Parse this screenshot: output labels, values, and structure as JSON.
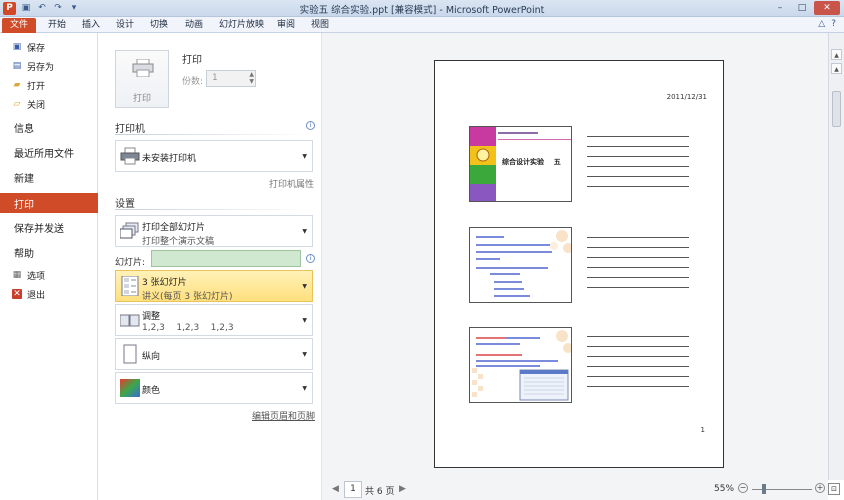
{
  "window": {
    "title": "实验五 综合实验.ppt [兼容模式] - Microsoft PowerPoint",
    "app_icon_letter": "P"
  },
  "ribbon": {
    "tabs": [
      "文件",
      "开始",
      "插入",
      "设计",
      "切换",
      "动画",
      "幻灯片放映",
      "审阅",
      "视图"
    ]
  },
  "nav": {
    "save": "保存",
    "save_as": "另存为",
    "open": "打开",
    "close": "关闭",
    "info": "信息",
    "recent": "最近所用文件",
    "new": "新建",
    "print": "打印",
    "save_send": "保存并发送",
    "help": "帮助",
    "options": "选项",
    "exit": "退出"
  },
  "print": {
    "button_label": "打印",
    "title": "打印",
    "copies_label": "份数:",
    "copies_value": "1"
  },
  "printer": {
    "heading": "打印机",
    "name": "未安装打印机",
    "properties_link": "打印机属性"
  },
  "settings": {
    "heading": "设置",
    "range_title": "打印全部幻灯片",
    "range_sub": "打印整个演示文稿",
    "slides_label": "幻灯片:",
    "slides_value": "",
    "layout_title": "3 张幻灯片",
    "layout_sub": "讲义(每页 3 张幻灯片)",
    "collate_title": "调整",
    "collate_sub": "1,2,3    1,2,3    1,2,3",
    "orientation": "纵向",
    "color": "颜色",
    "header_footer_link": "编辑页眉和页脚"
  },
  "preview": {
    "date": "2011/12/31",
    "page_number": "1",
    "slide1_title": "综合设计实验    五"
  },
  "pager": {
    "current_page": "1",
    "total": "共 6 页"
  },
  "zoom": {
    "level": "55%"
  },
  "colors": {
    "accent": "#d04b28",
    "highlight": "#ffe07d"
  }
}
